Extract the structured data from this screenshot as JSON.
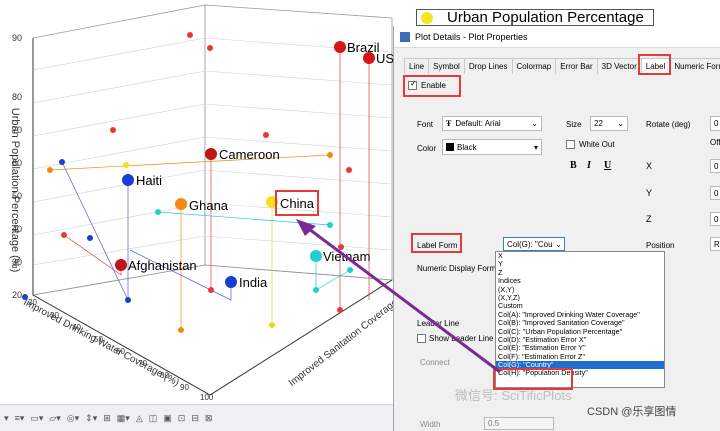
{
  "chart": {
    "legend_label": "Urban Population Percentage",
    "zlabel": "Urban Population Percentage (%)",
    "xlabel": "Improved Drinking Water Coverage (%)",
    "ylabel": "Improved Sanitation Coverage",
    "z_ticks": [
      "20",
      "30",
      "40",
      "50",
      "60",
      "70",
      "80",
      "90"
    ],
    "x_ticks": [
      "20",
      "30",
      "40",
      "50",
      "60",
      "70",
      "80",
      "90",
      "100"
    ],
    "points": [
      {
        "label": "Brazil",
        "color": "#e01010"
      },
      {
        "label": "US",
        "color": "#e01010"
      },
      {
        "label": "Cameroon",
        "color": "#c01515"
      },
      {
        "label": "Haiti",
        "color": "#1a3fd0"
      },
      {
        "label": "Ghana",
        "color": "#f08a10"
      },
      {
        "label": "China",
        "color": "#f0e020"
      },
      {
        "label": "Afghanistan",
        "color": "#c01515"
      },
      {
        "label": "India",
        "color": "#1a3fd0"
      },
      {
        "label": "Vietnam",
        "color": "#20d0d0"
      }
    ]
  },
  "dialog": {
    "title": "Plot Details - Plot Properties",
    "tabs": [
      "Line",
      "Symbol",
      "Drop Lines",
      "Colormap",
      "Error Bar",
      "3D Vector",
      "Label",
      "Numeric Form"
    ],
    "active_tab": "Label",
    "enable_label": "Enable",
    "font_label": "Font",
    "font_value": "Default: Arial",
    "size_label": "Size",
    "size_value": "22",
    "rotate_label": "Rotate (deg)",
    "rotate_value": "0",
    "color_label": "Color",
    "color_value": "Black",
    "whiteout_label": "White Out",
    "bold": "B",
    "italic": "I",
    "underline": "U",
    "x_label": "X",
    "y_label": "Y",
    "z_label": "Z",
    "off_label": "Off",
    "x_value": "0",
    "y_value": "0",
    "z_value": "0",
    "label_form_label": "Label Form",
    "label_form_value": "Col(G): \"Cou",
    "position_label": "Position",
    "position_value": "Ri",
    "numeric_display_label": "Numeric Display Format",
    "leader_line_label": "Leader Line",
    "show_leader_label": "Show Leader Line if O",
    "connect_label": "Connect",
    "width_label": "Width",
    "width_value": "0.5",
    "dropdown_options": [
      "X",
      "Y",
      "Z",
      "Indices",
      "(X,Y)",
      "(X,Y,Z)",
      "Custom",
      "Col(A): \"Improved Drinking Water Coverage\"",
      "Col(B): \"Improved Sanitation Coverage\"",
      "Col(C): \"Urban Population Percentage\"",
      "Col(D): \"Estimation Error X\"",
      "Col(E): \"Estimation Error Y\"",
      "Col(F): \"Estimation Error Z\"",
      "Col(G): \"Country\"",
      "Col(H): \"Population Density\""
    ],
    "selected_option": "Col(G): \"Country\""
  },
  "watermark": {
    "line1": "微信号: SciTificPlots",
    "line2": "CSDN @乐享图情"
  }
}
